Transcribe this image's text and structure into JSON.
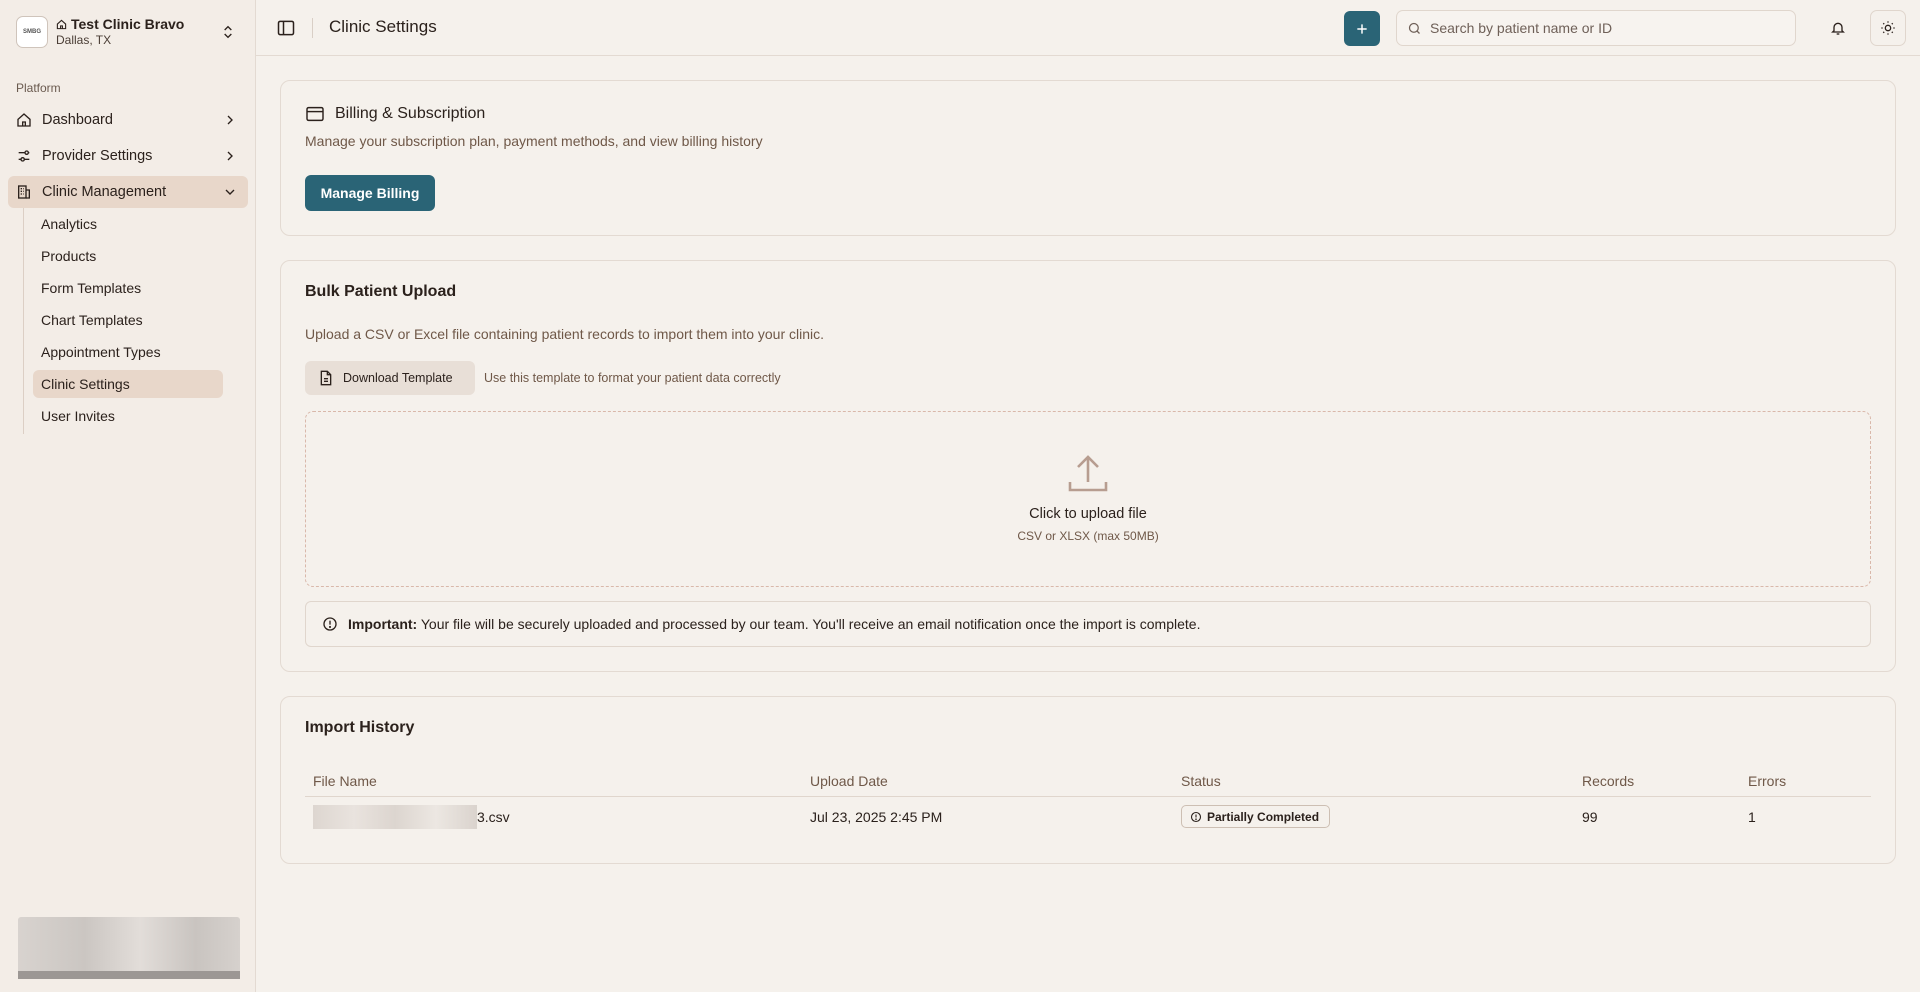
{
  "sidebar": {
    "clinic_name": "Test Clinic Bravo",
    "clinic_location": "Dallas, TX",
    "logo_text": "SMBG",
    "section_label": "Platform",
    "nav": {
      "dashboard": "Dashboard",
      "provider_settings": "Provider Settings",
      "clinic_management": "Clinic Management"
    },
    "sub_items": [
      "Analytics",
      "Products",
      "Form Templates",
      "Chart Templates",
      "Appointment Types",
      "Clinic Settings",
      "User Invites"
    ],
    "active_sub": "Clinic Settings"
  },
  "header": {
    "title": "Clinic Settings",
    "search_placeholder": "Search by patient name or ID"
  },
  "billing": {
    "title": "Billing & Subscription",
    "description": "Manage your subscription plan, payment methods, and view billing history",
    "button": "Manage Billing"
  },
  "upload": {
    "title": "Bulk Patient Upload",
    "description": "Upload a CSV or Excel file containing patient records to import them into your clinic.",
    "download_button": "Download Template",
    "download_hint": "Use this template to format your patient data correctly",
    "dropzone_title": "Click to upload file",
    "dropzone_sub": "CSV or XLSX (max 50MB)",
    "notice_bold": "Important:",
    "notice_text": "Your file will be securely uploaded and processed by our team. You'll receive an email notification once the import is complete."
  },
  "history": {
    "title": "Import History",
    "columns": [
      "File Name",
      "Upload Date",
      "Status",
      "Records",
      "Errors"
    ],
    "rows": [
      {
        "file_suffix": "3.csv",
        "date": "Jul 23, 2025 2:45 PM",
        "status": "Partially Completed",
        "records": "99",
        "errors": "1"
      }
    ]
  },
  "colors": {
    "accent": "#2a6476",
    "background": "#f5f1ec",
    "sidebar_active": "#e8d7ca"
  }
}
